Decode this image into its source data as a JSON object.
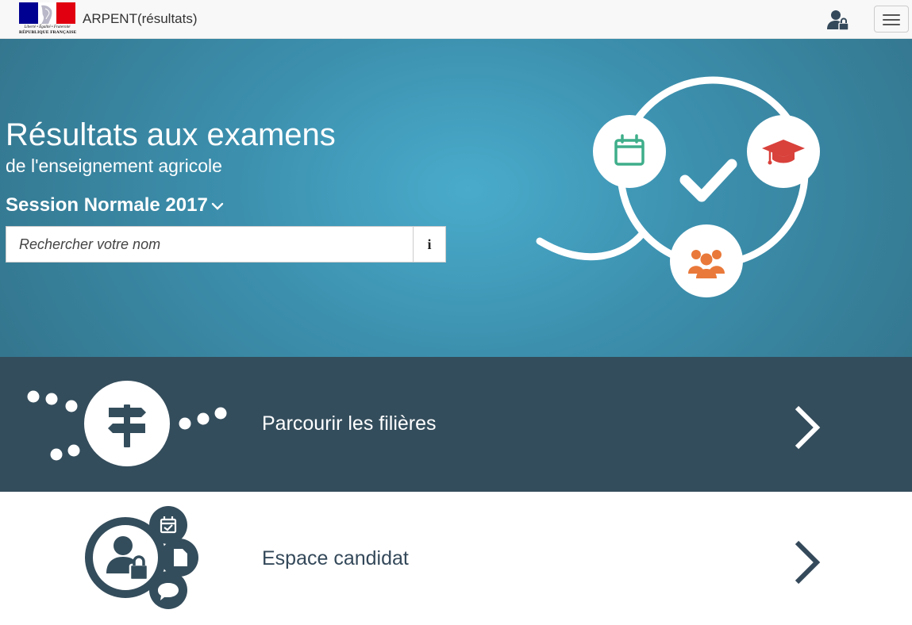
{
  "header": {
    "logo": {
      "motto": "Liberté • Égalité • Fraternité",
      "republic": "RÉPUBLIQUE FRANÇAISE",
      "colors": [
        "#000091",
        "#ffffff",
        "#e1000f"
      ]
    },
    "brand": "ARPENT(résultats)",
    "user_icon": "user-lock-icon",
    "menu_icon": "hamburger-menu-icon"
  },
  "hero": {
    "title": "Résultats aux examens",
    "subtitle": "de l'enseignement agricole",
    "session": "Session Normale 2017",
    "search": {
      "placeholder": "Rechercher votre nom",
      "value": "",
      "info_label": "i"
    },
    "illustration_icons": [
      "calendar-icon",
      "graduation-cap-icon",
      "check-icon",
      "users-icon"
    ],
    "colors": {
      "calendar": "#3fae8a",
      "graduation": "#d9413b",
      "users": "#e9793a"
    }
  },
  "sections": [
    {
      "label": "Parcourir les filières",
      "icon": "signpost-icon",
      "background": "#344d5c"
    },
    {
      "label": "Espace candidat",
      "icon": "user-lock-icon",
      "background": "#ffffff"
    }
  ]
}
